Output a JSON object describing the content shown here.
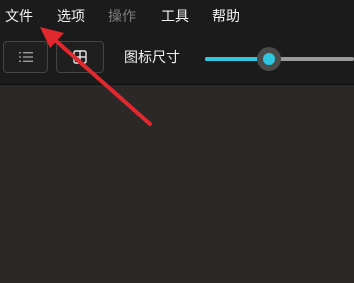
{
  "menubar": {
    "items": [
      {
        "label": "文件",
        "enabled": true
      },
      {
        "label": "选项",
        "enabled": true
      },
      {
        "label": "操作",
        "enabled": false
      },
      {
        "label": "工具",
        "enabled": true
      },
      {
        "label": "帮助",
        "enabled": true
      }
    ]
  },
  "toolbar": {
    "list_view_icon": "list-icon",
    "grid_view_icon": "grid-icon",
    "icon_size_label": "图标尺寸",
    "icon_size_level": 0.43
  },
  "colors": {
    "accent": "#2fc6e0",
    "annotation_arrow": "#e0282e",
    "menubar_bg": "#1b1b1b",
    "content_bg": "#2b2827"
  }
}
